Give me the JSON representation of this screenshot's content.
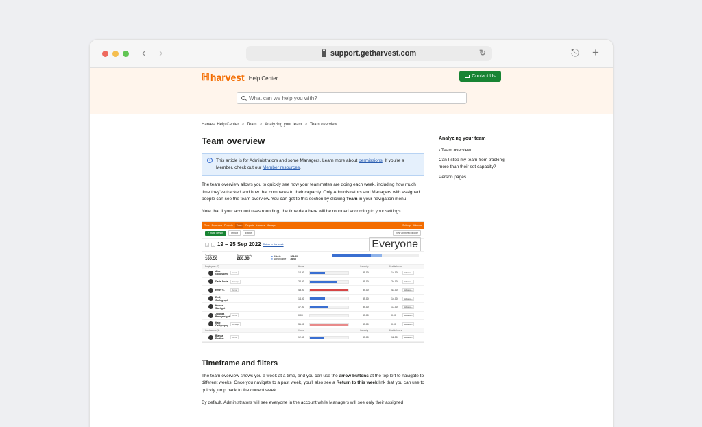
{
  "browser": {
    "url": "support.getharvest.com",
    "back_icon": "chevron-left-icon",
    "forward_icon": "chevron-right-icon"
  },
  "header": {
    "logo_text": "harvest",
    "logo_subtitle": "Help Center",
    "contact_label": "Contact Us",
    "search_placeholder": "What can we help you with?",
    "brand_color": "#f36c00",
    "contact_color": "#188433"
  },
  "breadcrumb": [
    "Harvest Help Center",
    "Team",
    "Analyzing your team",
    "Team overview"
  ],
  "article": {
    "title": "Team overview",
    "notice": {
      "text1": "This article is for Administrators and some Managers. Learn more about ",
      "link1": "permissions",
      "text2": ". If you're a Member, check out our ",
      "link2": "Member resources",
      "text3": "."
    },
    "p1a": "The team overview allows you to quickly see how your teammates are doing each week, including how much time they've tracked and how that compares to their capacity. Only Administrators and Managers with assigned people can see the team overview. You can get to this section by clicking ",
    "p1b": "Team",
    "p1c": " in your navigation menu.",
    "p2": "Note that if your account uses rounding, the time data here will be rounded according to your settings.",
    "h2": "Timeframe and filters",
    "p3a": "The team overview shows you a week at a time, and you can use the ",
    "p3b": "arrow buttons",
    "p3c": " at the top left to navigate to different weeks. Once you navigate to a past week, you'll also see a ",
    "p3d": "Return to this week",
    "p3e": " link that you can use to quickly jump back to the current week.",
    "p4": "By default, Administrators will see everyone in the account while Managers will see only their assigned"
  },
  "screenshot": {
    "nav": [
      "Time",
      "Expenses",
      "Projects",
      "Team",
      "Reports",
      "Invoices",
      "Manage"
    ],
    "nav_active": "Team",
    "nav_right": [
      "Settings",
      "Jolanda"
    ],
    "invite": "+ Invite person",
    "import": "Import",
    "export": "Export",
    "archived": "View archived people",
    "date_range": "19 – 25 Sep 2022",
    "return_link": "Return to this week",
    "filter": "Everyone",
    "total_hours_label": "Total hours",
    "total_hours": "160.50",
    "capacity_label": "Team capacity",
    "capacity": "280.00",
    "billable_label": "Billable",
    "billable": "124.50",
    "nonbillable_label": "Non-billable",
    "nonbillable": "36.00",
    "billable_fraction": 0.444,
    "nonbillable_fraction": 0.129,
    "employees_head": "Employees (7)",
    "contractors_head": "Contractors (1)",
    "col_hours": "Hours",
    "col_capacity": "Capacity",
    "col_billable": "Billable hours",
    "employees": [
      {
        "name": "Alex Goodspeed",
        "role": "Admin",
        "hours": "14.00",
        "capacity": "35.00",
        "billable": "14.00",
        "fill": 0.4,
        "color": "#3a6fd1"
      },
      {
        "name": "Daria Soda",
        "role": "Manager",
        "hours": "24.00",
        "capacity": "35.00",
        "billable": "24.00",
        "fill": 0.69,
        "color": "#3a6fd1"
      },
      {
        "name": "Emily C.",
        "role": "Owner",
        "hours": "43.00",
        "capacity": "35.00",
        "billable": "43.00",
        "fill": 1.0,
        "color": "#d64545"
      },
      {
        "name": "Emily Curlograph",
        "role": "",
        "hours": "14.00",
        "capacity": "35.00",
        "billable": "14.00",
        "fill": 0.4,
        "color": "#3a6fd1"
      },
      {
        "name": "Homer Starlight",
        "role": "",
        "hours": "17.00",
        "capacity": "35.00",
        "billable": "17.00",
        "fill": 0.49,
        "color": "#3a6fd1"
      },
      {
        "name": "Jolanda Pennywright",
        "role": "Admin",
        "hours": "0.00",
        "capacity": "35.00",
        "billable": "0.00",
        "fill": 0.0,
        "color": "#3a6fd1"
      },
      {
        "name": "Kate Calligraphy",
        "role": "Manager",
        "hours": "36.00",
        "capacity": "35.00",
        "billable": "0.00",
        "fill": 1.0,
        "color": "#e88a8a"
      }
    ],
    "contractors": [
      {
        "name": "Bianca Feather",
        "role": "Admin",
        "hours": "12.50",
        "capacity": "35.00",
        "billable": "12.50",
        "fill": 0.36,
        "color": "#3a6fd1"
      }
    ],
    "action": "Actions"
  },
  "sidebar": {
    "title": "Analyzing your team",
    "current": "Team overview",
    "items": [
      "Can I stop my team from tracking more than their set capacity?",
      "Person pages"
    ]
  }
}
